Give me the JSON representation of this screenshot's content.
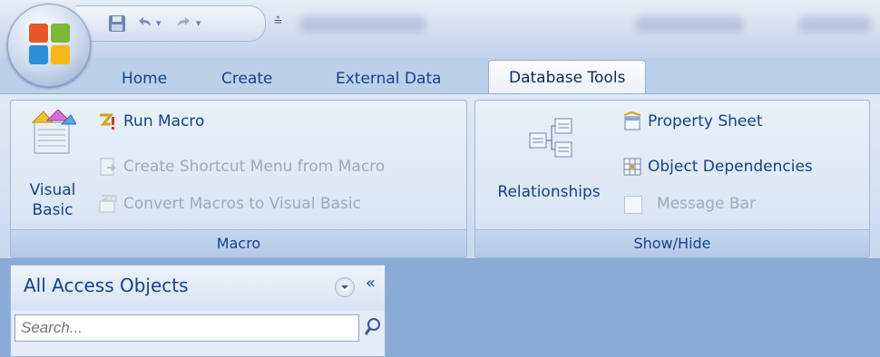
{
  "quick_access": {
    "save_icon": "save-icon",
    "undo_icon": "undo-icon",
    "redo_icon": "redo-icon",
    "customize_icon": "customize-qat-icon"
  },
  "tabs": [
    {
      "label": "Home"
    },
    {
      "label": "Create"
    },
    {
      "label": "External Data"
    },
    {
      "label": "Database Tools",
      "active": true
    }
  ],
  "groups": {
    "macro": {
      "label": "Macro",
      "visual_basic": "Visual Basic",
      "visual_basic_line1": "Visual",
      "visual_basic_line2": "Basic",
      "run_macro": "Run Macro",
      "create_shortcut": "Create Shortcut Menu from Macro",
      "convert_macros": "Convert Macros to Visual Basic"
    },
    "show_hide": {
      "label": "Show/Hide",
      "relationships": "Relationships",
      "property_sheet": "Property Sheet",
      "object_dependencies": "Object Dependencies",
      "message_bar": "Message Bar"
    }
  },
  "nav_pane": {
    "title": "All Access Objects",
    "collapse": "«",
    "search_placeholder": "Search..."
  },
  "colors": {
    "accent": "#15428b",
    "workspace": "#8aabd6",
    "disabled_text": "#9daabb"
  }
}
